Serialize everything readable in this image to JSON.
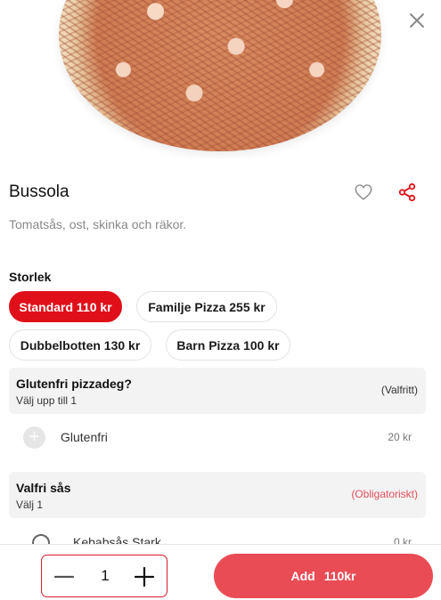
{
  "product": {
    "name": "Bussola",
    "description": "Tomatsås, ost, skinka och räkor."
  },
  "sizes": {
    "label": "Storlek",
    "options": [
      {
        "label": "Standard 110 kr",
        "selected": true
      },
      {
        "label": "Familje Pizza 255 kr",
        "selected": false
      },
      {
        "label": "Dubbelbotten 130 kr",
        "selected": false
      },
      {
        "label": "Barn Pizza 100 kr",
        "selected": false
      }
    ]
  },
  "groups": [
    {
      "title": "Glutenfri pizzadeg?",
      "subtitle": "Välj upp till 1",
      "tag": "(Valfritt)",
      "options": [
        {
          "label": "Glutenfri",
          "price": "20 kr"
        }
      ]
    },
    {
      "title": "Valfri sås",
      "subtitle": "Välj 1",
      "tag": "(Obligatoriskt)",
      "options": [
        {
          "label": "Kebabsås Stark",
          "price": "0 kr"
        }
      ]
    }
  ],
  "footer": {
    "quantity": "1",
    "add_label": "Add",
    "add_price": "110kr"
  },
  "colors": {
    "accent": "#e0101a",
    "add_button": "#ea4c56",
    "required": "#e0505a"
  },
  "icons": [
    "close-icon",
    "heart-icon",
    "share-icon",
    "plus-icon",
    "minus-icon",
    "radio-icon"
  ]
}
